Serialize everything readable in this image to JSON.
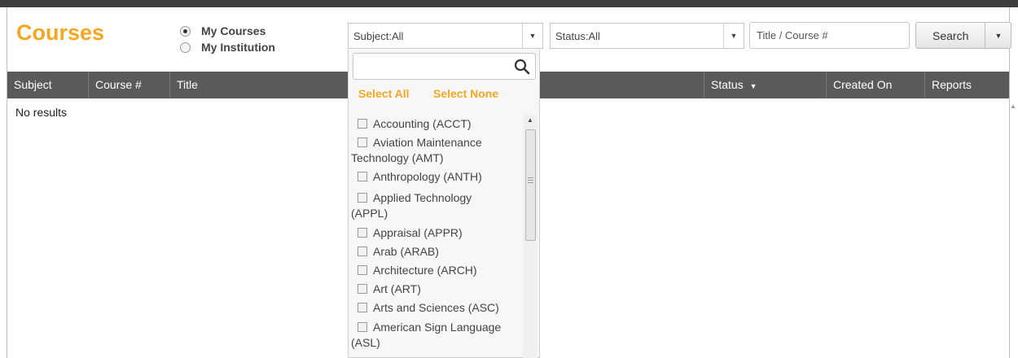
{
  "page": {
    "title": "Courses",
    "scope_options": [
      {
        "label": "My Courses",
        "checked": true
      },
      {
        "label": "My Institution",
        "checked": false
      }
    ]
  },
  "filters": {
    "subject": "Subject:All",
    "status": "Status:All",
    "title_placeholder": "Title / Course #",
    "search_label": "Search"
  },
  "table": {
    "columns": [
      "Subject",
      "Course #",
      "Title",
      "Status",
      "Created On",
      "Reports"
    ],
    "status_sort_glyph": "▼",
    "empty_message": "No results"
  },
  "subject_dropdown": {
    "search_value": "",
    "select_all": "Select All",
    "select_none": "Select None",
    "options": [
      "Accounting (ACCT)",
      "Aviation Maintenance",
      "Technology (AMT)",
      "Anthropology (ANTH)",
      "Applied Technology",
      "(APPL)",
      "Appraisal (APPR)",
      "Arab (ARAB)",
      "Architecture (ARCH)",
      "Art (ART)",
      "Arts and Sciences (ASC)",
      "American Sign Language",
      "(ASL)"
    ]
  },
  "icons": {
    "dropdown_arrow": "▼",
    "scroll_up": "▲",
    "magnifier": "search-icon"
  },
  "colors": {
    "accent": "#f5a623",
    "header_bg": "#5a5a5a"
  }
}
